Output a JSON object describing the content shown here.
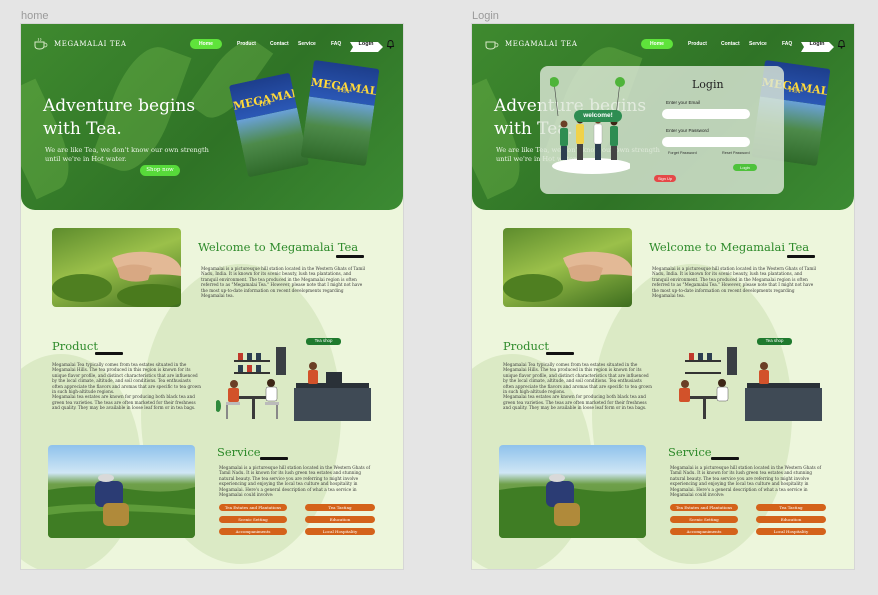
{
  "frames": {
    "home": {
      "label": "home"
    },
    "login": {
      "label": "Login"
    }
  },
  "nav": {
    "brand": "MEGAMALAI TEA",
    "items": [
      "Home",
      "Product",
      "Contact",
      "Service",
      "FAQ"
    ],
    "login": "Login"
  },
  "hero": {
    "title": "Adventure begins with Tea.",
    "subtitle": "We are like Tea, we don't know our own strength until we're in Hot water.",
    "shop_button": "Shop now",
    "pack_brand": "MEGAMALAI",
    "pack_sub": "TEA"
  },
  "welcome": {
    "title": "Welcome to Megamalai Tea",
    "text": "Megamalai is a picturesque hill station located in the Western Ghats of Tamil Nadu, India. It is known for its scenic beauty, lush tea plantations, and tranquil environment. The tea produced in the Megamalai region is often referred to as \"Megamalai Tea.\" However, please note that I might not have the most up-to-date information on recent developments regarding Megamalai tea."
  },
  "product": {
    "title": "Product",
    "text": "Megamalai Tea typically comes from tea estates situated in the Megamalai Hills. The tea produced in this region is known for its unique flavor profile, and distinct characteristics that are influenced by the local climate, altitude, and soil conditions. Tea enthusiasts often appreciate the flavors and aromas that are specific to tea grown in such high-altitude regions.\nMegamalai tea estates are known for producing both black tea and green tea varieties. The teas are often marketed for their freshness and quality. They may be available in loose leaf form or in tea bags.",
    "shop_sign": "Tea shop"
  },
  "service": {
    "title": "Service",
    "text": "Megamalai is a picturesque hill station located in the Western Ghats of Tamil Nadu. It is known for its lush green tea estates and stunning natural beauty. The tea service you are referring to might involve experiencing and enjoying the local tea culture and hospitality in Megamalai. Here's a general description of what a tea service in Megamalai could involve:",
    "buttons": [
      "Tea Estates and Plantations",
      "Tea Tasting",
      "Scenic Setting",
      "Education",
      "Accompaniments",
      "Local Hospitality"
    ]
  },
  "login_modal": {
    "title": "Login",
    "welcome": "welcome!",
    "email_label": "Enter your Email",
    "password_label": "Enter your Password",
    "forgot": "Forget Password",
    "reset": "Reset Password",
    "signup": "Sign Up",
    "login_button": "Login"
  },
  "colors": {
    "accent_green": "#57da3a",
    "hero_green": "#2f7326",
    "service_orange": "#d4621a",
    "title_green": "#2d8a2a"
  }
}
